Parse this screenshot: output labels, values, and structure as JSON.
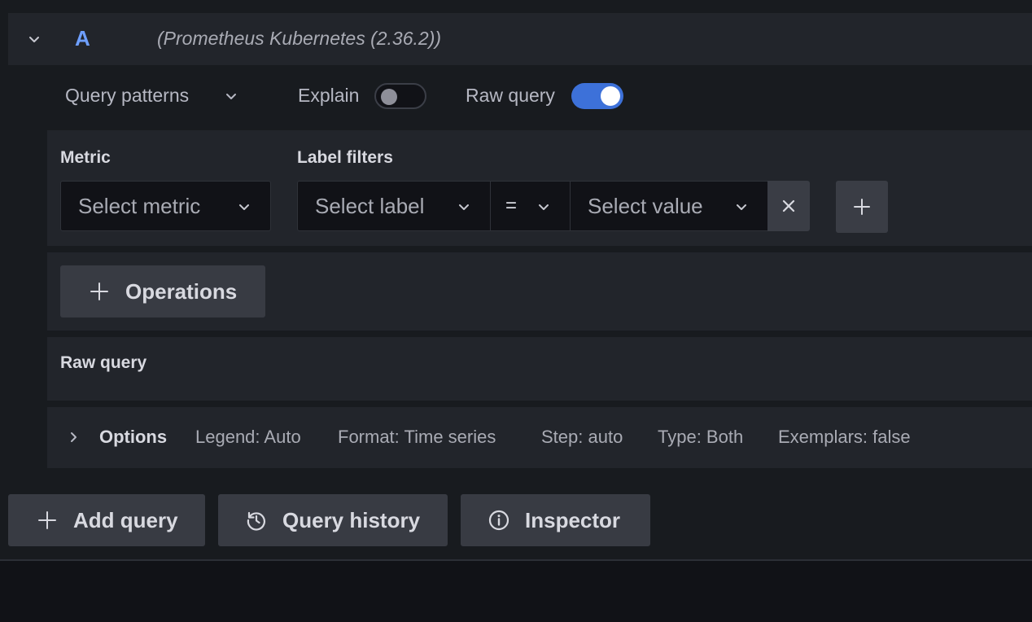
{
  "query": {
    "ref_id": "A",
    "datasource": "(Prometheus Kubernetes (2.36.2))"
  },
  "toolbar": {
    "query_patterns": "Query patterns",
    "explain": "Explain",
    "explain_enabled": false,
    "raw_query": "Raw query",
    "raw_query_enabled": true
  },
  "builder": {
    "metric_label": "Metric",
    "metric_placeholder": "Select metric",
    "label_filters_label": "Label filters",
    "label_placeholder": "Select label",
    "operator": "=",
    "value_placeholder": "Select value"
  },
  "operations": {
    "button_label": "Operations"
  },
  "raw": {
    "title": "Raw query"
  },
  "options": {
    "title": "Options",
    "legend": "Legend: Auto",
    "format": "Format: Time series",
    "step": "Step: auto",
    "type": "Type: Both",
    "exemplars": "Exemplars: false"
  },
  "actions": {
    "add_query": "Add query",
    "query_history": "Query history",
    "inspector": "Inspector"
  },
  "colors": {
    "accent": "#3d71d9",
    "ref_id": "#6e9fff"
  }
}
